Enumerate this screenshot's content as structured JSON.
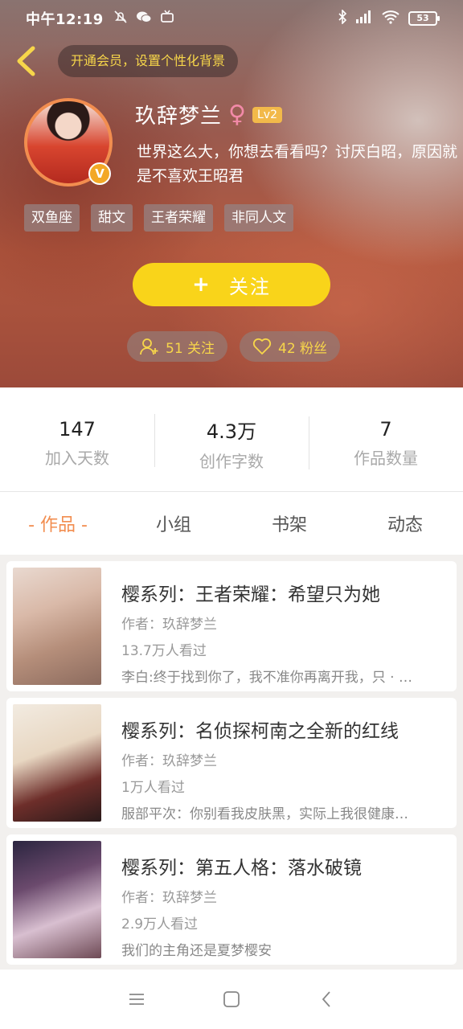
{
  "status": {
    "time": "中午12:19",
    "battery": "53"
  },
  "header": {
    "vip_banner": "开通会员，设置个性化背景",
    "username": "玖辞梦兰",
    "gender_symbol": "♀",
    "level": "Lv2",
    "vip_badge": "V",
    "bio": "世界这么大，你想去看看吗？讨厌白昭，原因就是不喜欢王昭君",
    "tags": [
      "双鱼座",
      "甜文",
      "王者荣耀",
      "非同人文"
    ],
    "follow_label": "关注",
    "follow_plus": "+",
    "following": "51 关注",
    "fans": "42 粉丝"
  },
  "stats": [
    {
      "value": "147",
      "label": "加入天数"
    },
    {
      "value": "4.3万",
      "label": "创作字数"
    },
    {
      "value": "7",
      "label": "作品数量"
    }
  ],
  "tabs": [
    "- 作品 -",
    "小组",
    "书架",
    "动态"
  ],
  "works": [
    {
      "title": "樱系列：王者荣耀：希望只为她",
      "author": "作者：玖辞梦兰",
      "views": "13.7万人看过",
      "snippet": "李白:终于找到你了，我不准你再离开我，只 · …"
    },
    {
      "title": "樱系列：名侦探柯南之全新的红线",
      "author": "作者：玖辞梦兰",
      "views": "1万人看过",
      "snippet": "服部平次：你别看我皮肤黑，实际上我很健康…"
    },
    {
      "title": "樱系列：第五人格：落水破镜",
      "author": "作者：玖辞梦兰",
      "views": "2.9万人看过",
      "snippet": "我们的主角还是夏梦樱安"
    }
  ],
  "colors": {
    "accent": "#f28d4f",
    "follow_button": "#f9d41a",
    "vip_text": "#f7d64a"
  }
}
